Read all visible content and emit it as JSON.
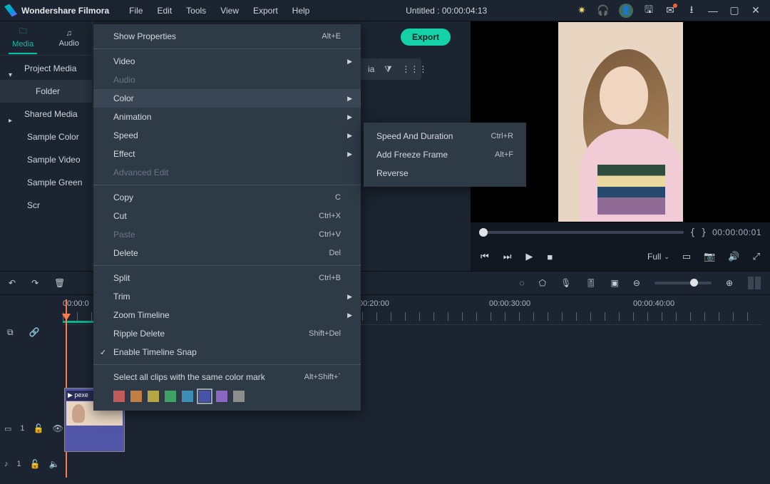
{
  "titlebar": {
    "app_name": "Wondershare Filmora",
    "menus": [
      "File",
      "Edit",
      "Tools",
      "View",
      "Export",
      "Help"
    ],
    "project_title": "Untitled : 00:00:04:13"
  },
  "library": {
    "tab_media": "Media",
    "tab_audio": "Audio",
    "items": {
      "project_media": "Project Media",
      "folder": "Folder",
      "shared_media": "Shared Media",
      "sample_color": "Sample Color",
      "sample_video": "Sample Video",
      "sample_green": "Sample Green Scr"
    }
  },
  "center": {
    "export_label": "Export",
    "search_frag": "ia"
  },
  "preview": {
    "timecode": "00:00:00:01",
    "brace_open": "{",
    "brace_close": "}",
    "full_label": "Full"
  },
  "ruler_labels": [
    "00:00:0",
    "00:20:00",
    "00:00:30:00",
    "00:00:40:00"
  ],
  "clip": {
    "title": "▶ pexe"
  },
  "tracks": {
    "video": "1",
    "audio": "1",
    "note_video": "♪",
    "note_audio": "♪"
  },
  "context": {
    "show_properties": {
      "label": "Show Properties",
      "sc": "Alt+E"
    },
    "video": "Video",
    "audio": "Audio",
    "color": "Color",
    "animation": "Animation",
    "speed": "Speed",
    "effect": "Effect",
    "advanced_edit": "Advanced Edit",
    "copy": {
      "label": "Copy",
      "sc": "C"
    },
    "cut": {
      "label": "Cut",
      "sc": "Ctrl+X"
    },
    "paste": {
      "label": "Paste",
      "sc": "Ctrl+V"
    },
    "delete": {
      "label": "Delete",
      "sc": "Del"
    },
    "split": {
      "label": "Split",
      "sc": "Ctrl+B"
    },
    "trim": "Trim",
    "zoom_timeline": "Zoom Timeline",
    "ripple_delete": {
      "label": "Ripple Delete",
      "sc": "Shift+Del"
    },
    "enable_snap": "Enable Timeline Snap",
    "select_mark": {
      "label": "Select all clips with the same color mark",
      "sc": "Alt+Shift+`"
    },
    "swatch_colors": [
      "#c15a5a",
      "#c17f45",
      "#b7a645",
      "#3fa265",
      "#3c8fb3",
      "#4653a7",
      "#8a68c1",
      "#8d8d8d"
    ]
  },
  "submenu": {
    "speed_duration": {
      "label": "Speed And Duration",
      "sc": "Ctrl+R"
    },
    "freeze": {
      "label": "Add Freeze Frame",
      "sc": "Alt+F"
    },
    "reverse": "Reverse"
  }
}
